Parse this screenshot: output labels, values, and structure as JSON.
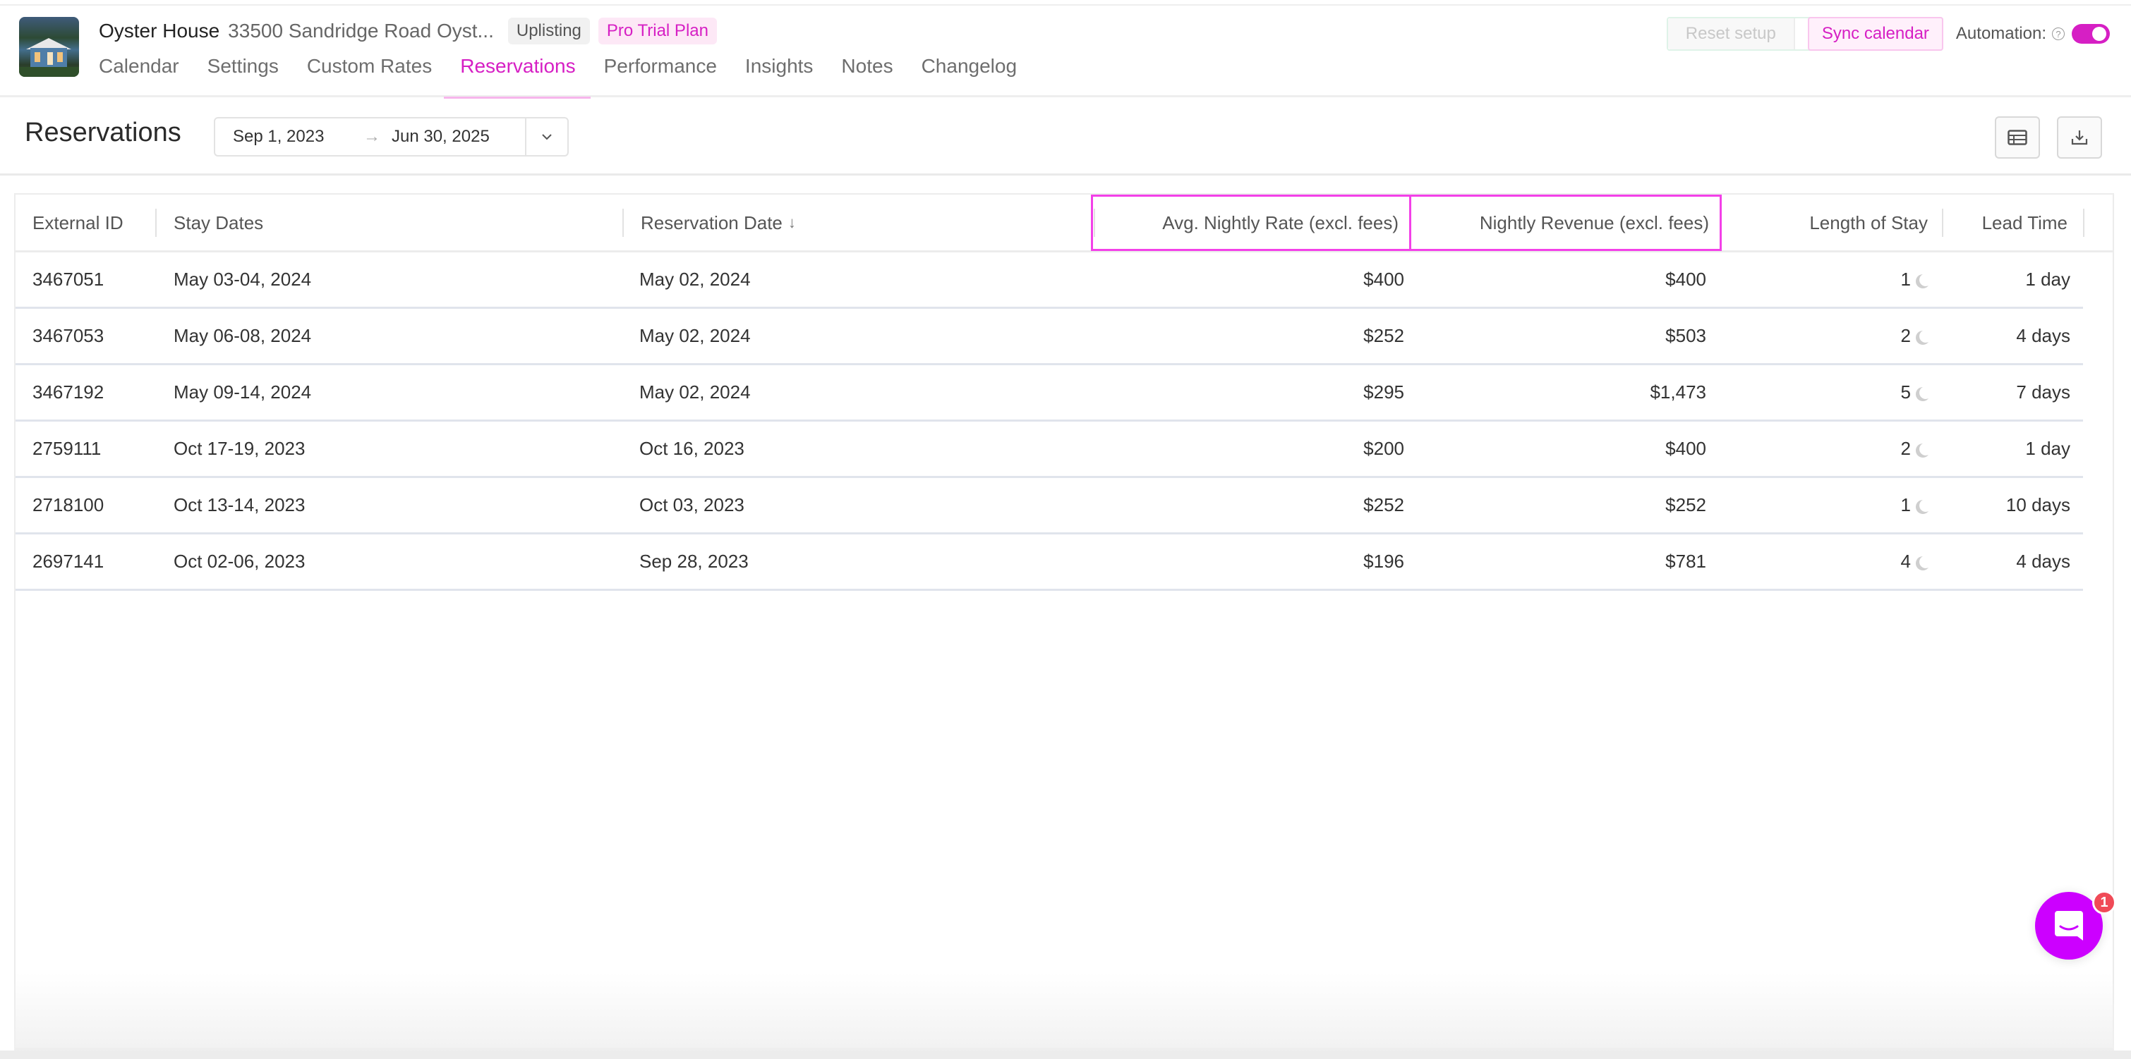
{
  "header": {
    "property_name": "Oyster House",
    "property_address": "33500 Sandridge Road Oyst...",
    "badges": [
      "Uplisting",
      "Pro Trial Plan"
    ],
    "tabs": [
      {
        "label": "Calendar",
        "active": false
      },
      {
        "label": "Settings",
        "active": false
      },
      {
        "label": "Custom Rates",
        "active": false
      },
      {
        "label": "Reservations",
        "active": true
      },
      {
        "label": "Performance",
        "active": false
      },
      {
        "label": "Insights",
        "active": false
      },
      {
        "label": "Notes",
        "active": false
      },
      {
        "label": "Changelog",
        "active": false
      }
    ],
    "reset_label": "Reset setup",
    "sync_label": "Sync calendar",
    "automation_label": "Automation:",
    "help_glyph": "?",
    "automation_enabled": true
  },
  "toolbar": {
    "title": "Reservations",
    "date_start": "Sep 1, 2023",
    "date_arrow": "→",
    "date_end": "Jun 30, 2025"
  },
  "table": {
    "columns": {
      "external_id": "External ID",
      "stay_dates": "Stay Dates",
      "reservation_date": "Reservation Date",
      "avg_nightly_rate": "Avg. Nightly Rate (excl. fees)",
      "nightly_revenue": "Nightly Revenue (excl. fees)",
      "length_of_stay": "Length of Stay",
      "lead_time": "Lead Time"
    },
    "sort_glyph": "↓",
    "rows": [
      {
        "external_id": "3467051",
        "stay_dates": "May 03-04, 2024",
        "reservation_date": "May 02, 2024",
        "avg_nightly_rate": "$400",
        "nightly_revenue": "$400",
        "length_of_stay": "1",
        "lead_time": "1 day"
      },
      {
        "external_id": "3467053",
        "stay_dates": "May 06-08, 2024",
        "reservation_date": "May 02, 2024",
        "avg_nightly_rate": "$252",
        "nightly_revenue": "$503",
        "length_of_stay": "2",
        "lead_time": "4 days"
      },
      {
        "external_id": "3467192",
        "stay_dates": "May 09-14, 2024",
        "reservation_date": "May 02, 2024",
        "avg_nightly_rate": "$295",
        "nightly_revenue": "$1,473",
        "length_of_stay": "5",
        "lead_time": "7 days"
      },
      {
        "external_id": "2759111",
        "stay_dates": "Oct 17-19, 2023",
        "reservation_date": "Oct 16, 2023",
        "avg_nightly_rate": "$200",
        "nightly_revenue": "$400",
        "length_of_stay": "2",
        "lead_time": "1 day"
      },
      {
        "external_id": "2718100",
        "stay_dates": "Oct 13-14, 2023",
        "reservation_date": "Oct 03, 2023",
        "avg_nightly_rate": "$252",
        "nightly_revenue": "$252",
        "length_of_stay": "1",
        "lead_time": "10 days"
      },
      {
        "external_id": "2697141",
        "stay_dates": "Oct 02-06, 2023",
        "reservation_date": "Sep 28, 2023",
        "avg_nightly_rate": "$196",
        "nightly_revenue": "$781",
        "length_of_stay": "4",
        "lead_time": "4 days"
      }
    ]
  },
  "chat": {
    "unread_count": "1"
  },
  "colors": {
    "accent": "#d61fc4",
    "chat": "#cc00ff",
    "badge_red": "#f04a57",
    "highlight_outline": "#f340e8"
  }
}
